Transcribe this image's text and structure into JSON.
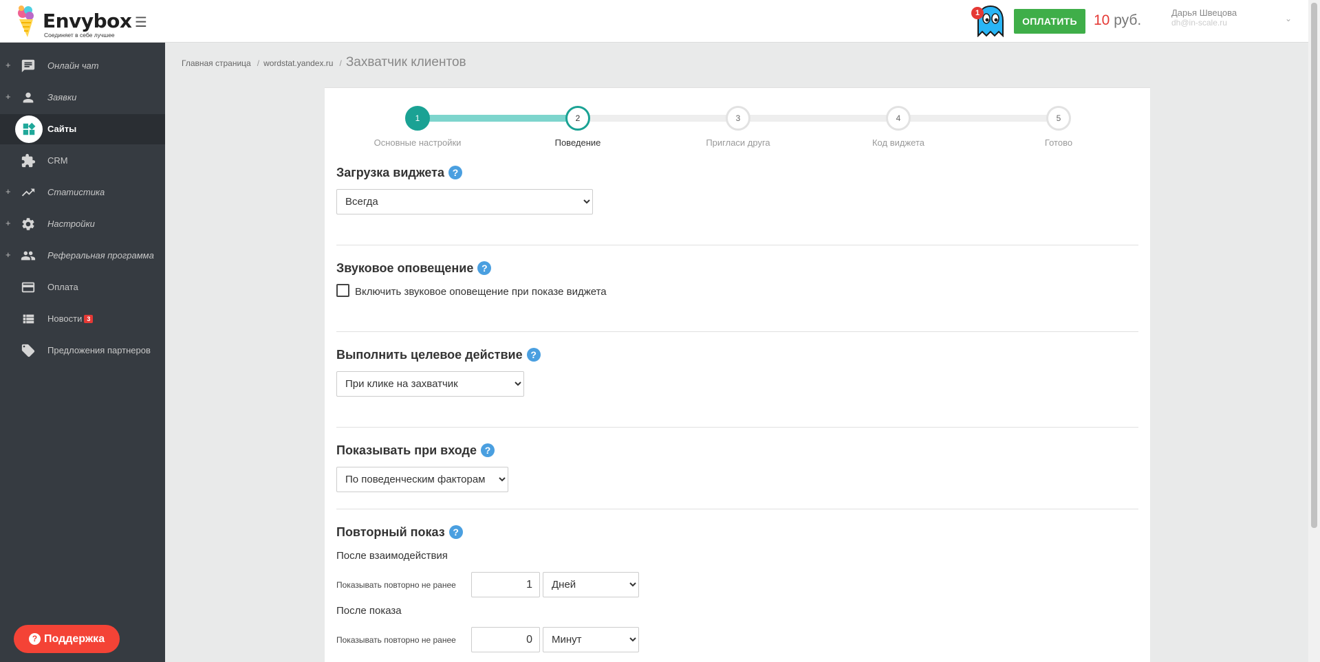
{
  "header": {
    "logo_name": "Envybox",
    "logo_tagline": "Соединяет в себе лучшее",
    "notification_count": "1",
    "pay_label": "ОПЛАТИТЬ",
    "balance_amount": "10",
    "balance_currency": "руб.",
    "user_name": "Дарья Швецова",
    "user_email": "dh@in-scale.ru"
  },
  "sidebar": {
    "items": [
      {
        "label": "Онлайн чат",
        "icon": "chat-icon",
        "expandable": true,
        "active": false
      },
      {
        "label": "Заявки",
        "icon": "person-icon",
        "expandable": true,
        "active": false
      },
      {
        "label": "Сайты",
        "icon": "widgets-icon",
        "expandable": false,
        "active": true
      },
      {
        "label": "CRM",
        "icon": "puzzle-icon",
        "expandable": false,
        "active": false
      },
      {
        "label": "Статистика",
        "icon": "trending-up-icon",
        "expandable": true,
        "active": false
      },
      {
        "label": "Настройки",
        "icon": "gear-icon",
        "expandable": true,
        "active": false
      },
      {
        "label": "Реферальная программа",
        "icon": "group-icon",
        "expandable": true,
        "active": false
      },
      {
        "label": "Оплата",
        "icon": "credit-card-icon",
        "expandable": false,
        "active": false
      },
      {
        "label": "Новости",
        "icon": "list-icon",
        "expandable": false,
        "active": false,
        "badge": "3"
      },
      {
        "label": "Предложения партнеров",
        "icon": "tag-icon",
        "expandable": false,
        "active": false
      }
    ],
    "support_label": "Поддержка"
  },
  "breadcrumb": {
    "home": "Главная страница",
    "site": "wordstat.yandex.ru",
    "current": "Захватчик клиентов"
  },
  "stepper": {
    "current_step": 2,
    "steps": [
      {
        "number": "1",
        "label": "Основные настройки"
      },
      {
        "number": "2",
        "label": "Поведение"
      },
      {
        "number": "3",
        "label": "Пригласи друга"
      },
      {
        "number": "4",
        "label": "Код виджета"
      },
      {
        "number": "5",
        "label": "Готово"
      }
    ]
  },
  "sections": {
    "widget_load": {
      "title": "Загрузка виджета",
      "help": "?",
      "selected": "Всегда"
    },
    "sound": {
      "title": "Звуковое оповещение",
      "help": "?",
      "checkbox_label": "Включить звуковое оповещение при показе виджета",
      "checked": false
    },
    "target_action": {
      "title": "Выполнить целевое действие",
      "help": "?",
      "selected": "При клике на захватчик"
    },
    "show_on_enter": {
      "title": "Показывать при входе",
      "help": "?",
      "selected": "По поведенческим факторам"
    },
    "repeat_show": {
      "title": "Повторный показ",
      "help": "?",
      "after_interaction_label": "После взаимодействия",
      "after_interaction_prompt": "Показывать повторно не ранее",
      "after_interaction_value": "1",
      "after_interaction_unit": "Дней",
      "after_show_label": "После показа",
      "after_show_prompt": "Показывать повторно не ранее",
      "after_show_value": "0",
      "after_show_unit": "Минут"
    }
  },
  "colors": {
    "accent": "#1aa294",
    "progress": "#7dd5cd",
    "pay_button": "#3fae49",
    "support_button": "#f44336",
    "help_icon": "#4a9fe0",
    "sidebar": "#363b41"
  }
}
